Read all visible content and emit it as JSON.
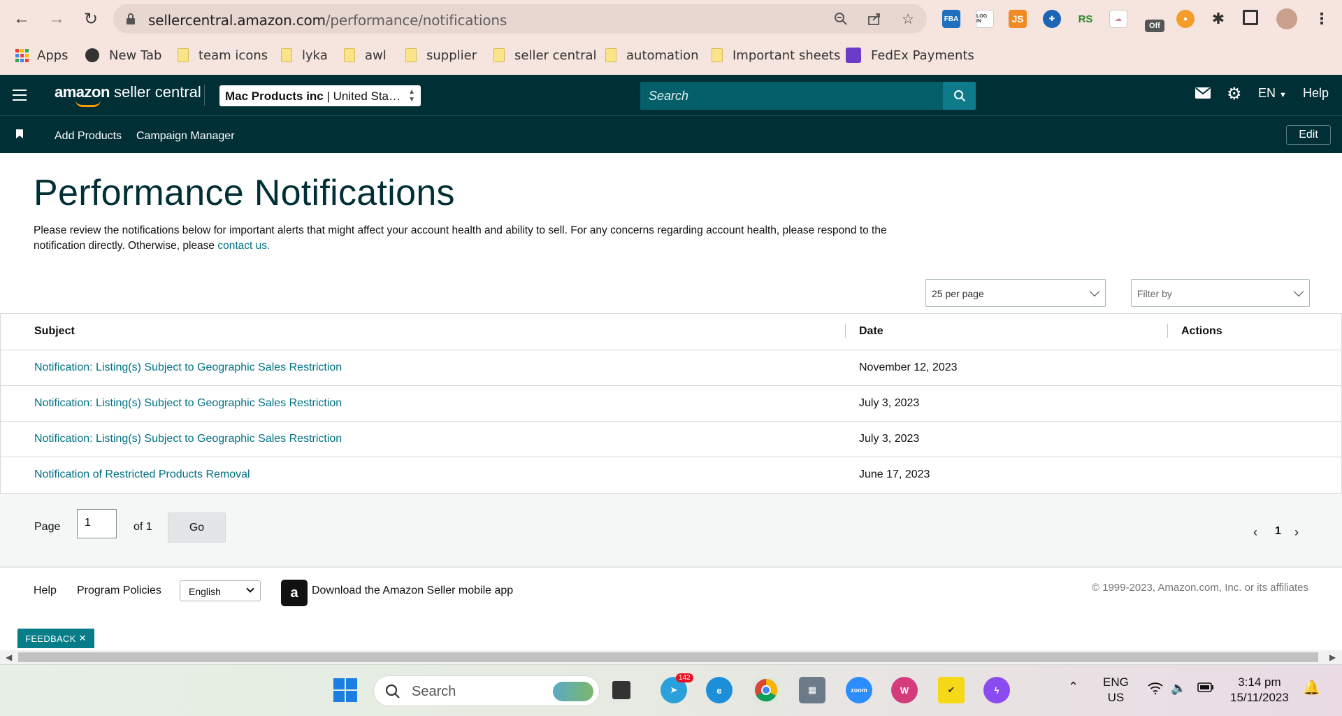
{
  "browser": {
    "url_host": "sellercentral.amazon.com",
    "url_path": "/performance/notifications",
    "bookmarks": [
      "Apps",
      "New Tab",
      "team icons",
      "lyka",
      "awl",
      "supplier",
      "seller central",
      "automation",
      "Important sheets",
      "FedEx Payments"
    ],
    "extensions": [
      "FBA",
      "LOG IN",
      "JS",
      "RS",
      "Off"
    ]
  },
  "header": {
    "logo_brand": "amazon",
    "logo_text": "seller central",
    "account_name": "Mac Products inc",
    "account_market": " | United Sta…",
    "search_placeholder": "Search",
    "language": "EN",
    "help": "Help",
    "sub_links": [
      "Add Products",
      "Campaign Manager"
    ],
    "edit": "Edit"
  },
  "main": {
    "title": "Performance Notifications",
    "intro": "Please review the notifications below for important alerts that might affect your account health and ability to sell. For any concerns regarding account health, please respond to the notification directly. Otherwise, please ",
    "contact_link": "contact us.",
    "per_page": "25 per page",
    "filter_placeholder": "Filter by",
    "columns": [
      "Subject",
      "Date",
      "Actions"
    ],
    "rows": [
      {
        "subject": "Notification: Listing(s) Subject to Geographic Sales Restriction",
        "date": "November 12, 2023"
      },
      {
        "subject": "Notification: Listing(s) Subject to Geographic Sales Restriction",
        "date": "July 3, 2023"
      },
      {
        "subject": "Notification: Listing(s) Subject to Geographic Sales Restriction",
        "date": "July 3, 2023"
      },
      {
        "subject": "Notification of Restricted Products Removal",
        "date": "June 17, 2023"
      }
    ],
    "pager": {
      "page_label": "Page",
      "page_value": "1",
      "of_label": "of 1",
      "go": "Go",
      "current": "1"
    }
  },
  "footer": {
    "help": "Help",
    "policies": "Program Policies",
    "language": "English",
    "app_text": "Download the Amazon Seller mobile app",
    "copyright": "© 1999-2023, Amazon.com, Inc. or its affiliates",
    "feedback": "FEEDBACK"
  },
  "taskbar": {
    "search": "Search",
    "telegram_badge": "142",
    "zoom_label": "zoom",
    "lang_top": "ENG",
    "lang_bottom": "US",
    "time": "3:14 pm",
    "date": "15/11/2023"
  }
}
